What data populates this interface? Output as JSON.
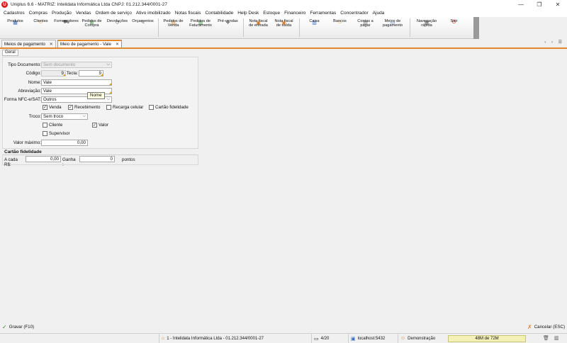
{
  "window": {
    "logo": "U",
    "title": "Uniplus 6.6 - MATRIZ: Intelidata Informática Ltda CNPJ: 01.212.344/0001-27",
    "controls": [
      "—",
      "❐",
      "✕"
    ]
  },
  "menu": [
    "Cadastros",
    "Compras",
    "Produção",
    "Vendas",
    "Ordem de serviço",
    "Ativo imobilizado",
    "Notas fiscais",
    "Contabilidade",
    "Help Desk",
    "Estoque",
    "Financeiro",
    "Ferramentas",
    "Concentrador",
    "Ajuda"
  ],
  "toolbar": [
    {
      "label": "Produtos",
      "icon": "box-icon",
      "glyph": "▦",
      "color": "#3a6fc4"
    },
    {
      "label": "Clientes",
      "icon": "person-icon",
      "glyph": "☺",
      "color": "#d08b2a"
    },
    {
      "label": "Fornecedores",
      "icon": "truck-icon",
      "glyph": "⛟",
      "color": "#6a6a6a"
    },
    {
      "label": "Pedidos de\nCompra",
      "icon": "cart-icon",
      "glyph": "⊞",
      "color": "#3a8a3a"
    },
    {
      "label": "Devoluções",
      "icon": "return-icon",
      "glyph": "↺",
      "color": "#777"
    },
    {
      "label": "Orçamentos",
      "icon": "quote-icon",
      "glyph": "✎",
      "color": "#777"
    },
    {
      "label": "Pedidos de\nVenda",
      "icon": "sales-order-icon",
      "glyph": "▤",
      "color": "#c98a2d"
    },
    {
      "label": "Pedidos de\nFaturamento",
      "icon": "billing-icon",
      "glyph": "▥",
      "color": "#3a8a3a"
    },
    {
      "label": "Pré-vendas",
      "icon": "presale-icon",
      "glyph": "✚",
      "color": "#777"
    },
    {
      "label": "Nota fiscal\nde entrada",
      "icon": "invoice-in-icon",
      "glyph": "▣",
      "color": "#d9822b"
    },
    {
      "label": "Nota fiscal\nde saída",
      "icon": "invoice-out-icon",
      "glyph": "▣",
      "color": "#d9822b"
    },
    {
      "label": "Caixa",
      "icon": "cash-icon",
      "glyph": "▥",
      "color": "#3a6fc4"
    },
    {
      "label": "Bancos",
      "icon": "bank-icon",
      "glyph": "⌂",
      "color": "#d08b2a"
    },
    {
      "label": "Contas a\npagar",
      "icon": "bills-icon",
      "glyph": "▤",
      "color": "#777"
    },
    {
      "label": "Meios de\npagamento",
      "icon": "payment-icon",
      "glyph": "▭",
      "color": "#3a6fc4"
    },
    {
      "label": "Navegação\nrápida",
      "icon": "navigation-icon",
      "glyph": "▦",
      "color": "#777"
    },
    {
      "label": "Sair",
      "icon": "exit-icon",
      "glyph": "⏻",
      "color": "#d62020"
    }
  ],
  "tabs": [
    {
      "label": "Meios de pagamento",
      "close": "✕",
      "active": false
    },
    {
      "label": "Meio de pagamento - Vale",
      "close": "✕",
      "active": true
    }
  ],
  "tab_nav": "‹ › ☰",
  "subtab": "Geral",
  "form": {
    "tipo_documento": {
      "label": "Tipo Documento:",
      "value": "Sem documento"
    },
    "codigo": {
      "label": "Código:",
      "value": "9"
    },
    "tecla": {
      "label": "Tecla:",
      "value": "9"
    },
    "nome": {
      "label": "Nome:",
      "value": "Vale"
    },
    "abreviacao": {
      "label": "Abreviação:",
      "value": "Vale"
    },
    "forma_nfce": {
      "label": "Forma NFC-e/SAT:",
      "value": "Outros"
    },
    "venda": {
      "label": "Venda",
      "checked": true
    },
    "recebimento": {
      "label": "Recebimento",
      "checked": true
    },
    "recarga": {
      "label": "Recarga celular",
      "checked": false
    },
    "cartao": {
      "label": "Cartão fidelidade",
      "checked": false
    },
    "troco": {
      "label": "Troco:",
      "value": "Sem troco"
    },
    "cliente": {
      "label": "Cliente",
      "checked": false
    },
    "valor": {
      "label": "Valor",
      "checked": true
    },
    "supervisor": {
      "label": "Supervisor",
      "checked": false
    },
    "valor_maximo": {
      "label": "Valor máximo:",
      "value": "0,00"
    },
    "tooltip": "Nome",
    "check_mark": "✓",
    "dropdown_arrow": "⌵"
  },
  "fidelidade": {
    "title": "Cartão fidelidade",
    "cada_label": "A cada R$:",
    "cada_value": "0,00",
    "ganha_label": "Ganha :",
    "ganha_value": "0",
    "pontos": "pontos"
  },
  "actions": {
    "save": "Gravar (F10)",
    "save_icon": "✓",
    "cancel": "Cancelar (ESC)",
    "cancel_icon": "✗"
  },
  "status": {
    "company": "1 - Intelidata Informática Ltda - 01.212.344/0001-27",
    "company_icon": "⌂",
    "pages": "4/20",
    "pages_icon": "▭",
    "server": "localhost:5432",
    "server_icon": "▣",
    "user": "Demonstração",
    "user_icon": "☺",
    "memory": "48M de 72M",
    "trash_icon": "🗑",
    "windows_icon": "▥"
  }
}
